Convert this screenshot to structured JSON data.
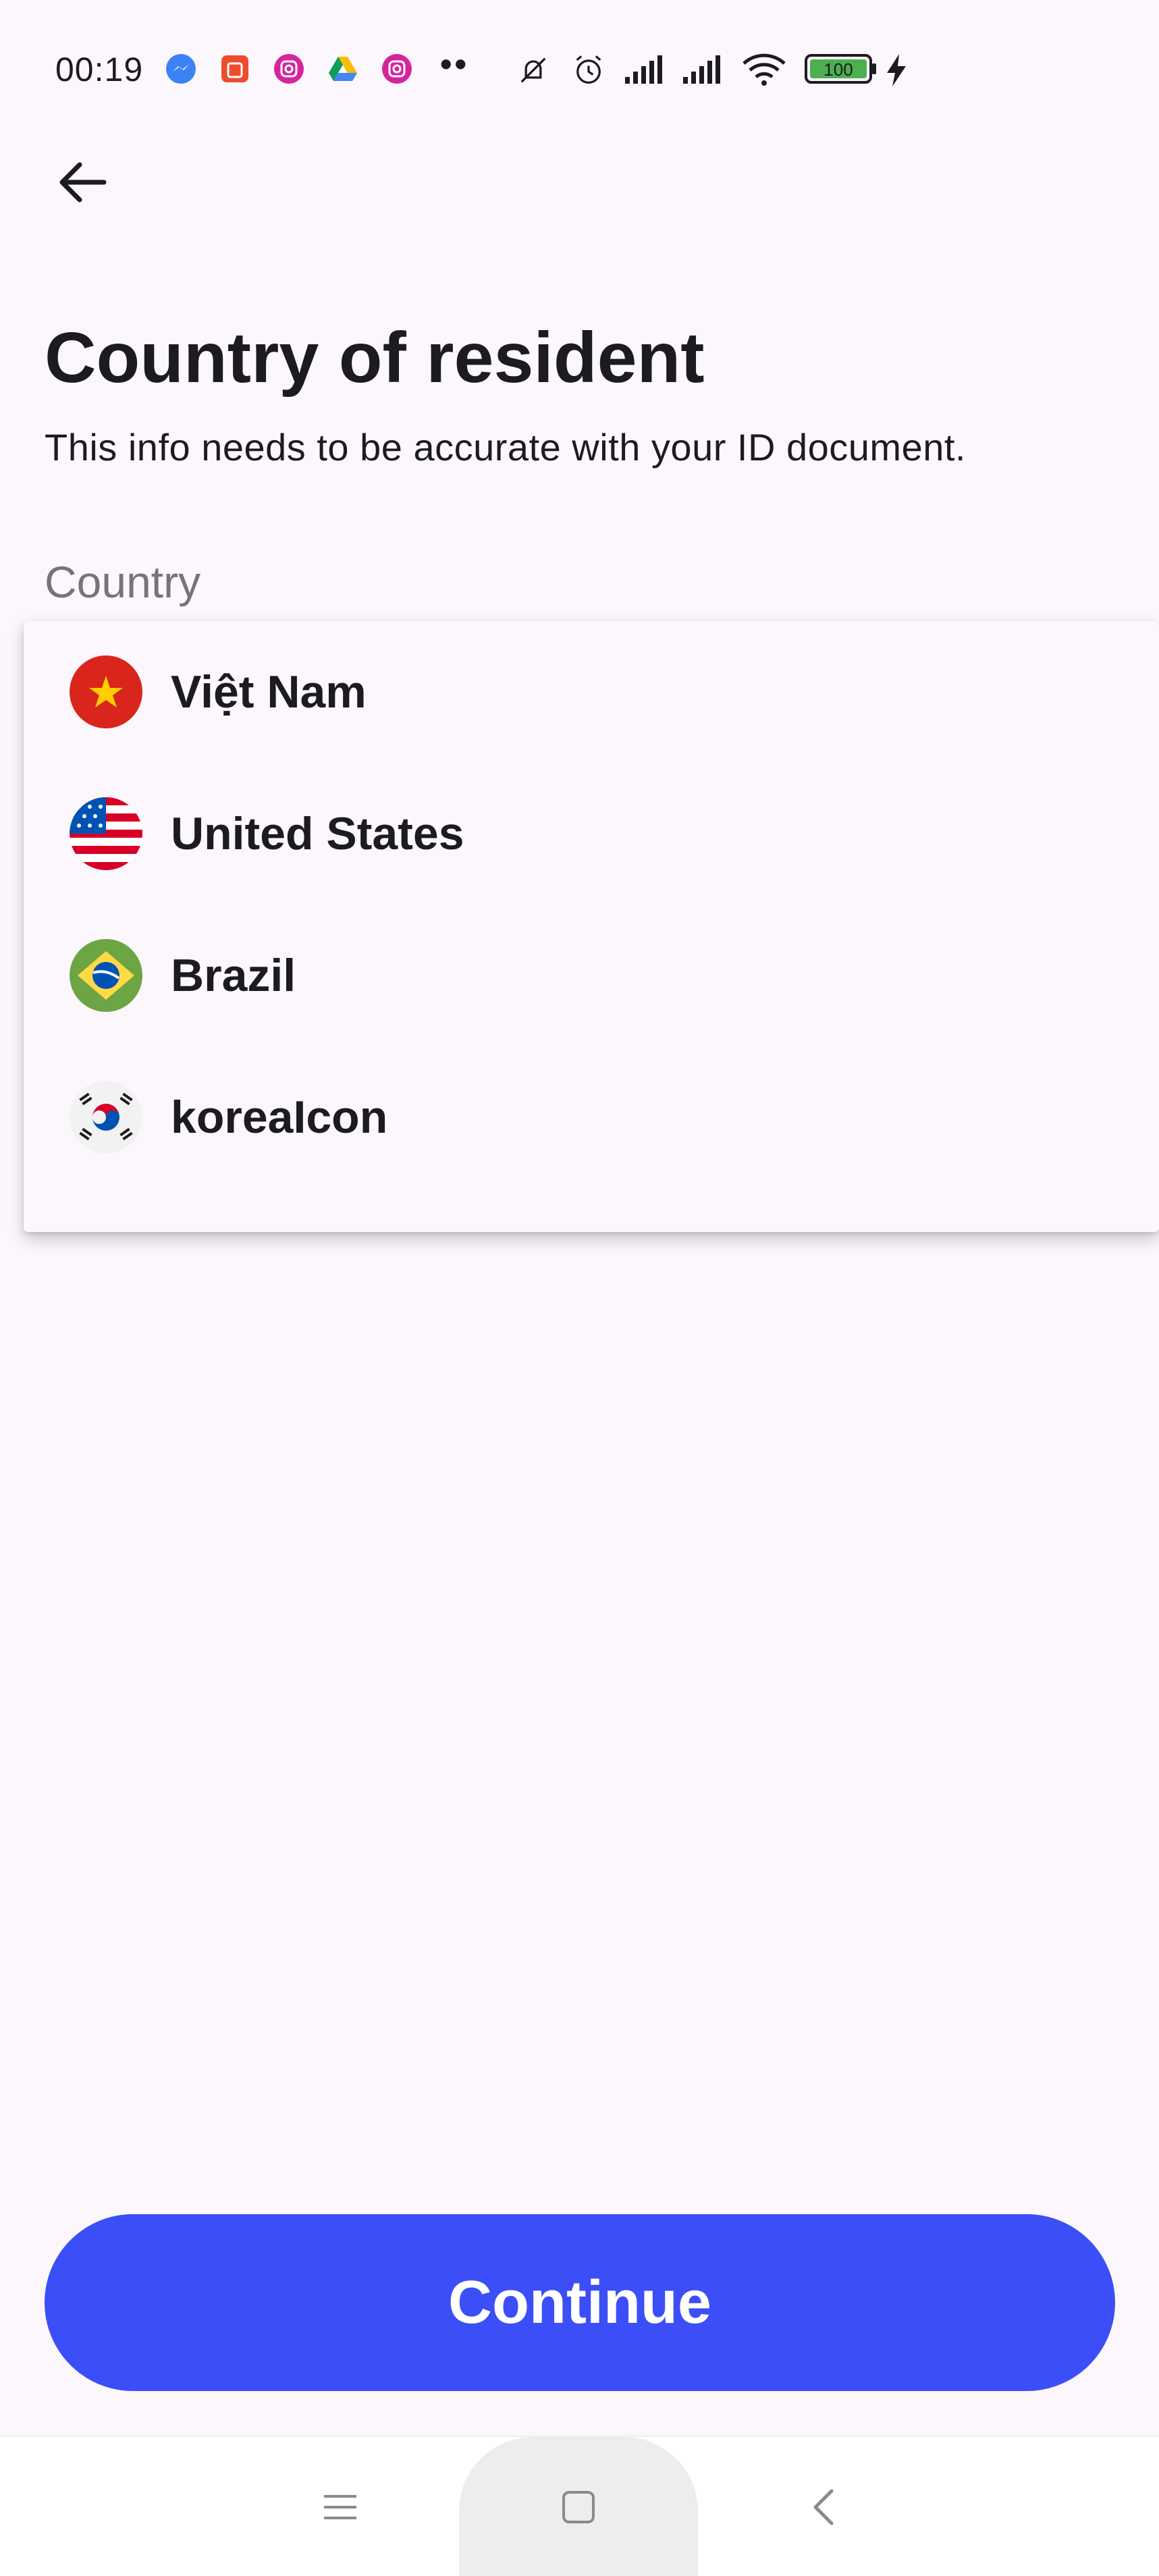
{
  "status_bar": {
    "time": "00:19",
    "notification_icons": [
      "messenger-icon",
      "shopee-icon",
      "instagram-icon",
      "google-drive-icon",
      "instagram-icon"
    ],
    "more": "••",
    "system_icons": [
      "silent-icon",
      "alarm-icon",
      "signal-icon",
      "signal-icon",
      "wifi-icon",
      "battery-icon",
      "charging-icon"
    ],
    "battery": "100"
  },
  "header": {
    "back_icon": "arrow-left-icon",
    "title": "Country of resident",
    "subtitle": "This info needs to be accurate with your ID document."
  },
  "field": {
    "label": "Country"
  },
  "dropdown": {
    "options": [
      {
        "label": "Việt Nam",
        "flag": "vietnam-flag-icon"
      },
      {
        "label": "United States",
        "flag": "us-flag-icon"
      },
      {
        "label": "Brazil",
        "flag": "brazil-flag-icon"
      },
      {
        "label": "koreaIcon",
        "flag": "korea-flag-icon"
      }
    ]
  },
  "actions": {
    "continue_label": "Continue",
    "continue_color": "#3b4ef7"
  },
  "nav_bar": {
    "icons": [
      "menu-icon",
      "home-icon",
      "back-icon"
    ]
  }
}
